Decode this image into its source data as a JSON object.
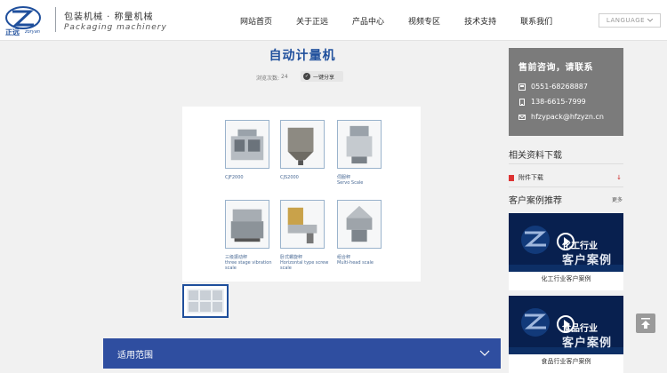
{
  "header": {
    "logo_cn": "正远",
    "logo_en": "zoryan",
    "slogan_cn": "包装机械 · 称量机械",
    "slogan_en": "Packaging machinery",
    "nav": [
      "网站首页",
      "关于正远",
      "产品中心",
      "视频专区",
      "技术支持",
      "联系我们"
    ],
    "language_label": "LANGUAGE"
  },
  "product": {
    "title": "自动计量机",
    "views_label": "浏览次数:",
    "views_count": "24",
    "share_label": "一键分享",
    "items": [
      {
        "label": "CJF2000",
        "label_en": ""
      },
      {
        "label": "CJS2000",
        "label_en": ""
      },
      {
        "label": "伺服秤",
        "label_en": "Servo Scale"
      },
      {
        "label": "三级振动秤",
        "label_en": "three stage vibration scale"
      },
      {
        "label": "卧式螺旋秤",
        "label_en": "Horizontal type screw scale"
      },
      {
        "label": "组合秤",
        "label_en": "Multi-head scale"
      }
    ]
  },
  "scope": {
    "label": "适用范围"
  },
  "sidebar": {
    "contact_title": "售前咨询，请联系",
    "phone": "0551-68268887",
    "mobile": "138-6615-7999",
    "email": "hfzypack@hfzyzn.cn",
    "downloads_title": "相关资料下载",
    "download_item": "附件下载",
    "cases_title": "客户案例推荐",
    "more_label": "更多",
    "cases": [
      {
        "overlay_small": "化工行业",
        "overlay_big": "客户案例",
        "caption": "化工行业客户案例"
      },
      {
        "overlay_small": "食品行业",
        "overlay_big": "客户案例",
        "caption": "食品行业客户案例"
      }
    ]
  },
  "colors": {
    "primary": "#1f4f9c",
    "bar": "#2f4ea0",
    "contact_bg": "#7b7b7b"
  }
}
